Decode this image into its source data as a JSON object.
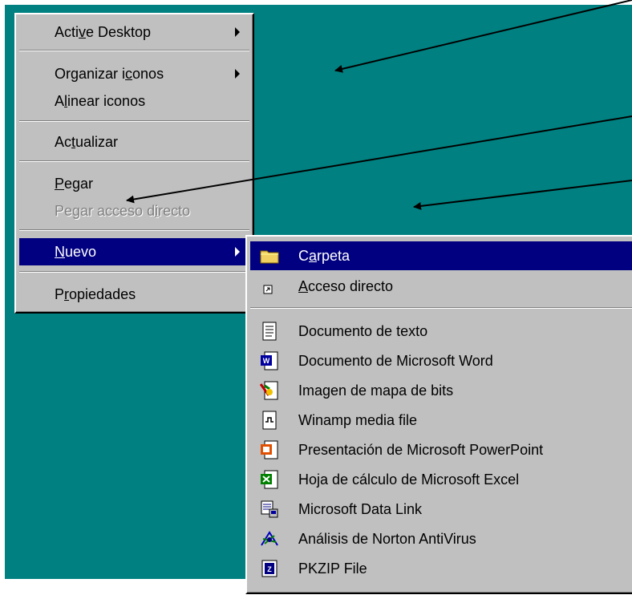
{
  "desktop": {
    "background": "#008080"
  },
  "context_menu": {
    "items": [
      {
        "pre": "Acti",
        "key": "v",
        "post": "e Desktop"
      },
      {
        "pre": "Organizar i",
        "key": "c",
        "post": "onos"
      },
      {
        "pre": "A",
        "key": "l",
        "post": "inear iconos"
      },
      {
        "pre": "Ac",
        "key": "t",
        "post": "ualizar"
      },
      {
        "pre": "",
        "key": "P",
        "post": "egar"
      },
      {
        "pre": "Pegar acceso d",
        "key": "i",
        "post": "recto"
      },
      {
        "pre": "",
        "key": "N",
        "post": "uevo"
      },
      {
        "pre": "P",
        "key": "r",
        "post": "opiedades"
      }
    ]
  },
  "new_submenu": {
    "items": [
      {
        "pre": "C",
        "key": "a",
        "post": "rpeta",
        "icon": "folder-icon"
      },
      {
        "pre": "",
        "key": "A",
        "post": "cceso directo",
        "icon": "shortcut-icon"
      },
      {
        "label": "Documento de texto",
        "icon": "text-document-icon"
      },
      {
        "label": "Documento de Microsoft Word",
        "icon": "word-document-icon"
      },
      {
        "label": "Imagen de mapa de bits",
        "icon": "bitmap-image-icon"
      },
      {
        "label": "Winamp media file",
        "icon": "winamp-media-icon"
      },
      {
        "label": "Presentación de Microsoft PowerPoint",
        "icon": "powerpoint-icon"
      },
      {
        "label": "Hoja de cálculo de Microsoft Excel",
        "icon": "excel-icon"
      },
      {
        "label": "Microsoft Data Link",
        "icon": "data-link-icon"
      },
      {
        "label": "Análisis de Norton AntiVirus",
        "icon": "norton-antivirus-icon"
      },
      {
        "label": "PKZIP File",
        "icon": "pkzip-icon"
      }
    ]
  },
  "colors": {
    "menu": "#c0c0c0",
    "highlight": "#000080",
    "disabled": "#808080"
  }
}
